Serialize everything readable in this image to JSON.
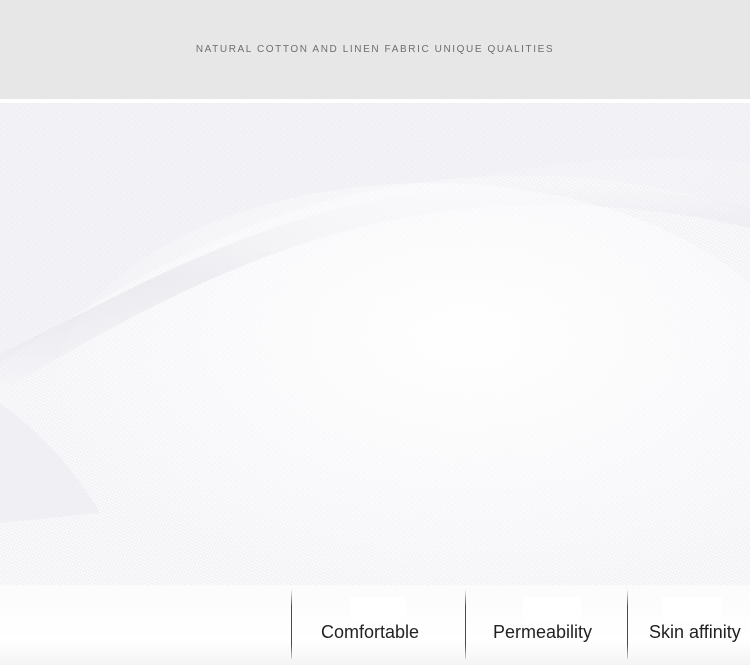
{
  "header": {
    "title": "NATURAL COTTON AND LINEN FABRIC UNIQUE QUALITIES"
  },
  "photo": {
    "subject": "white linen fabric close-up",
    "icon": "fabric-texture-image"
  },
  "features": [
    {
      "label": "Comfortable",
      "icon": "comfortable-icon"
    },
    {
      "label": "Permeability",
      "icon": "permeability-icon"
    },
    {
      "label": "Skin affinity",
      "icon": "skin-affinity-icon"
    }
  ],
  "colors": {
    "header_bg": "#e7e7e7",
    "header_text": "#6e6e6e",
    "fabric": "#f7f7fa",
    "label_text": "#222222",
    "divider": "#4a4a4a"
  }
}
